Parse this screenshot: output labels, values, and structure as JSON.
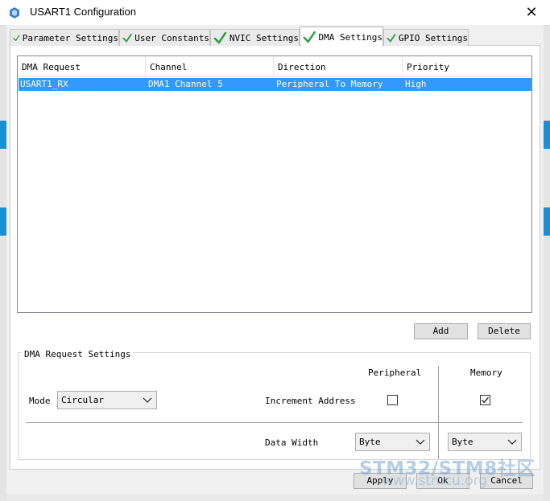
{
  "window": {
    "title": "USART1 Configuration",
    "close_glyph": "✕"
  },
  "tabs": [
    {
      "label": "Parameter Settings",
      "icon": "check-icon"
    },
    {
      "label": "User Constants",
      "icon": "check-icon"
    },
    {
      "label": "NVIC Settings",
      "icon": "check-icon"
    },
    {
      "label": "DMA Settings",
      "icon": "check-icon",
      "active": true
    },
    {
      "label": "GPIO Settings",
      "icon": "check-icon"
    }
  ],
  "table": {
    "columns": [
      "DMA Request",
      "Channel",
      "Direction",
      "Priority"
    ],
    "rows": [
      [
        "USART1_RX",
        "DMA1 Channel 5",
        "Peripheral To Memory",
        "High"
      ]
    ],
    "selected_row": 0
  },
  "actions": {
    "add": "Add",
    "delete": "Delete"
  },
  "settings": {
    "group_title": "DMA Request Settings",
    "mode_label": "Mode",
    "mode_value": "Circular",
    "peripheral_header": "Peripheral",
    "memory_header": "Memory",
    "increment_label": "Increment Address",
    "increment_peripheral": false,
    "increment_memory": true,
    "data_width_label": "Data Width",
    "data_width_peripheral": "Byte",
    "data_width_memory": "Byte"
  },
  "footer": {
    "apply": "Apply",
    "ok": "Ok",
    "cancel": "Cancel"
  },
  "watermark": {
    "line1": "STM32/STM8社区",
    "line2": "www.stmcu.org"
  },
  "colors": {
    "selection": "#3399ff",
    "check": "#2ea043"
  }
}
